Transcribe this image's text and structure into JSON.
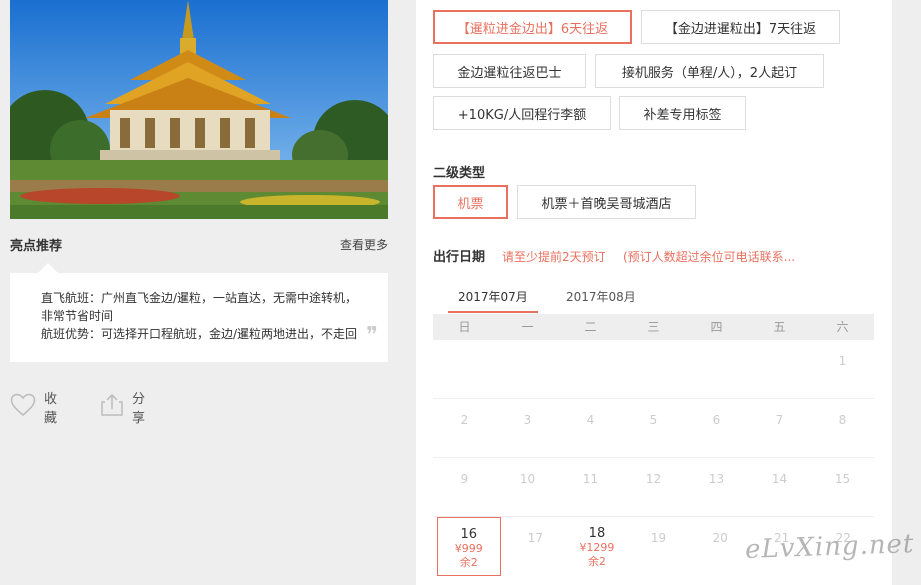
{
  "highlights": {
    "title": "亮点推荐",
    "more": "查看更多",
    "lines": [
      "直飞航班：广州直飞金边/暹粒，一站直达，无需中途转机，",
      "非常节省时间",
      "航班优势：可选择开口程航班，金边/暹粒两地进出，不走回"
    ],
    "quote_mark": "❞"
  },
  "actions": {
    "favorite": "收藏",
    "share": "分享"
  },
  "primary_options": [
    {
      "label": "【暹粒进金边出】6天往返",
      "selected": true
    },
    {
      "label": "【金边进暹粒出】7天往返",
      "selected": false
    },
    {
      "label": "金边暹粒往返巴士",
      "selected": false
    },
    {
      "label": "接机服务（单程/人），2人起订",
      "selected": false
    },
    {
      "label": "+10KG/人回程行李额",
      "selected": false
    },
    {
      "label": "补差专用标签",
      "selected": false
    }
  ],
  "secondary": {
    "label": "二级类型",
    "options": [
      {
        "label": "机票",
        "selected": true
      },
      {
        "label": "机票＋首晚吴哥城酒店",
        "selected": false
      }
    ]
  },
  "date": {
    "label": "出行日期",
    "tip1": "请至少提前2天预订",
    "tip2": "(预订人数超过余位可电话联系..."
  },
  "months": [
    "2017年07月",
    "2017年08月"
  ],
  "weekdays": [
    "日",
    "一",
    "二",
    "三",
    "四",
    "五",
    "六"
  ],
  "calendar": [
    [
      "",
      "",
      "",
      "",
      "",
      "",
      "1"
    ],
    [
      "2",
      "3",
      "4",
      "5",
      "6",
      "7",
      "8"
    ],
    [
      "9",
      "10",
      "11",
      "12",
      "13",
      "14",
      "15"
    ],
    [
      "16",
      "17",
      "18",
      "19",
      "20",
      "21",
      "22"
    ]
  ],
  "available": {
    "16": {
      "price": "¥999",
      "left": "余2",
      "selected": true
    },
    "18": {
      "price": "¥1299",
      "left": "余2",
      "selected": false
    }
  },
  "watermark": "eLvXing.net",
  "colors": {
    "accent": "#e9705f",
    "bg": "#eeeeee"
  }
}
